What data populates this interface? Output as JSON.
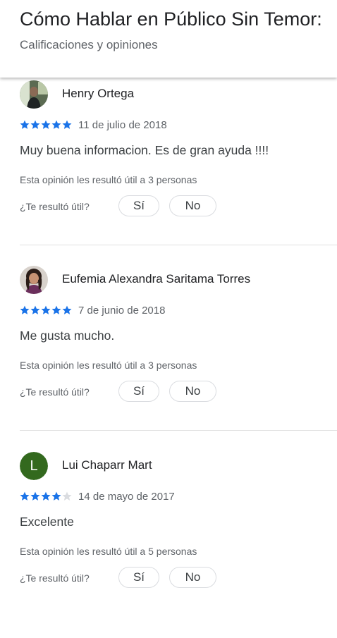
{
  "header": {
    "title": "Cómo Hablar en Público Sin Temor:",
    "subtitle": "Calificaciones y opiniones"
  },
  "colors": {
    "star_filled": "#1a73e8",
    "star_empty": "#dadce0",
    "avatar_letter_bg": "#33691e"
  },
  "helpful_question": "¿Te resultó útil?",
  "yes_label": "Sí",
  "no_label": "No",
  "reviews": [
    {
      "author": "Henry Ortega",
      "avatar": "photo",
      "rating": 5,
      "max_rating": 5,
      "date": "11 de julio de 2018",
      "text": "Muy buena informacion. Es de gran ayuda !!!!",
      "helpful_count": "Esta opinión les resultó útil a 3 personas"
    },
    {
      "author": "Eufemia Alexandra Saritama Torres",
      "avatar": "photo",
      "rating": 5,
      "max_rating": 5,
      "date": "7 de junio de 2018",
      "text": "Me gusta mucho.",
      "helpful_count": "Esta opinión les resultó útil a 3 personas"
    },
    {
      "author": "Lui Chaparr Mart",
      "avatar": "letter",
      "avatar_letter": "L",
      "rating": 4,
      "max_rating": 5,
      "date": "14 de mayo de 2017",
      "text": "Excelente",
      "helpful_count": "Esta opinión les resultó útil a 5 personas"
    }
  ]
}
